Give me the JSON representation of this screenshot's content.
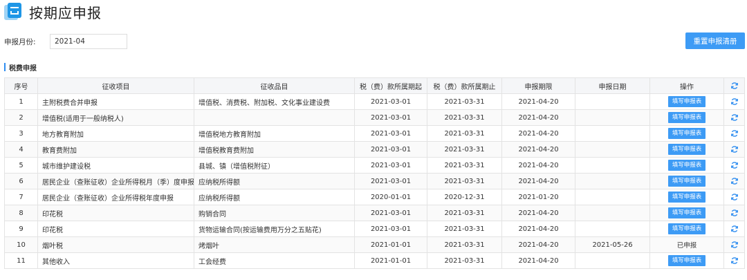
{
  "header": {
    "title": "按期应申报"
  },
  "filter": {
    "month_label": "申报月份:",
    "month_value": "2021-04"
  },
  "toolbar": {
    "reset_label": "重置申报清册"
  },
  "section": {
    "title": "税费申报"
  },
  "table": {
    "columns": [
      "序号",
      "征收项目",
      "征收品目",
      "税（费）款所属期起",
      "税（费）款所属期止",
      "申报期限",
      "申报日期",
      "操作"
    ],
    "rows": [
      {
        "no": "1",
        "item": "主附税费合并申报",
        "subitem": "增值税、消费税、附加税、文化事业建设费",
        "start": "2021-03-01",
        "end": "2021-03-31",
        "deadline": "2021-04-20",
        "date": "",
        "action": "填写申报表"
      },
      {
        "no": "2",
        "item": "增值税(适用于一般纳税人)",
        "subitem": "",
        "start": "2021-03-01",
        "end": "2021-03-31",
        "deadline": "2021-04-20",
        "date": "",
        "action": "填写申报表"
      },
      {
        "no": "3",
        "item": "地方教育附加",
        "subitem": "增值税地方教育附加",
        "start": "2021-03-01",
        "end": "2021-03-31",
        "deadline": "2021-04-20",
        "date": "",
        "action": "填写申报表"
      },
      {
        "no": "4",
        "item": "教育费附加",
        "subitem": "增值税教育费附加",
        "start": "2021-03-01",
        "end": "2021-03-31",
        "deadline": "2021-04-20",
        "date": "",
        "action": "填写申报表"
      },
      {
        "no": "5",
        "item": "城市维护建设税",
        "subitem": "县城、镇（增值税附征）",
        "start": "2021-03-01",
        "end": "2021-03-31",
        "deadline": "2021-04-20",
        "date": "",
        "action": "填写申报表"
      },
      {
        "no": "6",
        "item": "居民企业（查账征收）企业所得税月（季）度申报",
        "subitem": "应纳税所得额",
        "start": "2021-03-01",
        "end": "2021-03-31",
        "deadline": "2021-04-20",
        "date": "",
        "action": "填写申报表"
      },
      {
        "no": "7",
        "item": "居民企业（查账征收）企业所得税年度申报",
        "subitem": "应纳税所得额",
        "start": "2020-01-01",
        "end": "2020-12-31",
        "deadline": "2021-01-20",
        "date": "",
        "action": "填写申报表"
      },
      {
        "no": "8",
        "item": "印花税",
        "subitem": "购销合同",
        "start": "2021-03-01",
        "end": "2021-03-31",
        "deadline": "2021-04-20",
        "date": "",
        "action": "填写申报表"
      },
      {
        "no": "9",
        "item": "印花税",
        "subitem": "货物运输合同(按运输费用万分之五贴花)",
        "start": "2021-03-01",
        "end": "2021-03-31",
        "deadline": "2021-04-20",
        "date": "",
        "action": "填写申报表"
      },
      {
        "no": "10",
        "item": "烟叶税",
        "subitem": "烤烟叶",
        "start": "2021-01-01",
        "end": "2021-03-31",
        "deadline": "2021-04-20",
        "date": "2021-05-26",
        "status": "已申报"
      },
      {
        "no": "11",
        "item": "其他收入",
        "subitem": "工会经费",
        "start": "2021-01-01",
        "end": "2021-03-31",
        "deadline": "2021-04-20",
        "date": "",
        "action": "填写申报表"
      }
    ]
  },
  "icons": {
    "logo": "declaration-form-icon",
    "refresh": "refresh-icon"
  },
  "colors": {
    "accent": "#3d9bf5",
    "header_bg": "#f5f6f8",
    "border": "#e3e3e3"
  }
}
